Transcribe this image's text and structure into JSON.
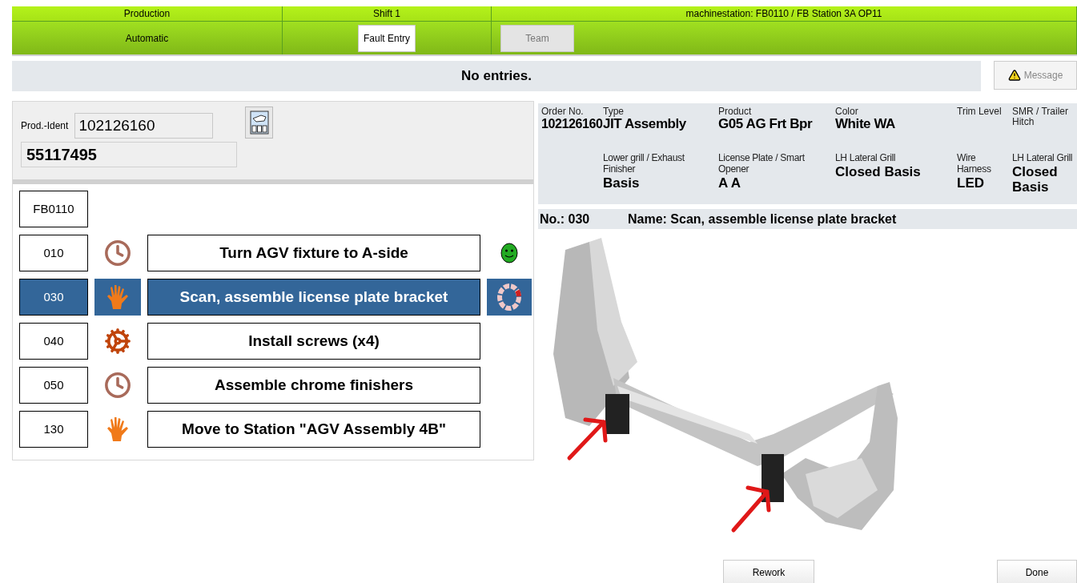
{
  "header": {
    "row_1": [
      "Production",
      "Shift 1",
      "machinestation: FB0110 / FB Station 3A OP11"
    ],
    "mode": "Automatic",
    "buttons": [
      {
        "label": "Fault Entry",
        "disabled": false
      },
      {
        "label": "Team",
        "disabled": true
      }
    ]
  },
  "message_bar": {
    "text": "No entries.",
    "button": {
      "label": "Message",
      "disabled": true
    }
  },
  "prod_ident": {
    "label": "Prod.-Ident",
    "value": "102126160",
    "second_value": "55117495"
  },
  "station": "FB0110",
  "steps": [
    {
      "number": "010",
      "kind": "timed",
      "name": "Turn AGV fixture to A-side",
      "status": {
        "kind": "ok"
      },
      "selected": false
    },
    {
      "number": "030",
      "kind": "manual",
      "name": "Scan, assemble license plate bracket",
      "status": {
        "kind": "running"
      },
      "selected": true
    },
    {
      "number": "040",
      "kind": "screwing",
      "name": "Install screws (x4)",
      "selected": false
    },
    {
      "number": "050",
      "kind": "timed",
      "name": "Assemble chrome finishers",
      "selected": false
    },
    {
      "number": "130",
      "kind": "manual",
      "name": "Move to Station \"AGV Assembly 4B\"",
      "selected": false
    }
  ],
  "order_info": {
    "row_1": [
      {
        "label": "Order No.",
        "value": "102126160"
      },
      {
        "label": "Type",
        "value": "JIT Assembly"
      },
      {
        "label": "Product",
        "value": "G05 AG Frt Bpr"
      },
      {
        "label": "Color",
        "value": "White WA"
      },
      {
        "label": "Trim Level"
      },
      {
        "label": "SMR / Trailer Hitch"
      }
    ],
    "row_2": [
      {
        "label": "Lower grill / Exhaust Finisher",
        "value": "Basis"
      },
      {
        "label": "License Plate / Smart Opener",
        "value": "A A"
      },
      {
        "label": "LH Lateral Grill",
        "value": "Closed Basis"
      },
      {
        "label": "Wire Harness",
        "value": "LED"
      },
      {
        "label": "LH Lateral Grill",
        "value": "Closed Basis"
      }
    ]
  },
  "current_step": {
    "number": "No.: 030",
    "name": "Name: Scan, assemble license plate bracket"
  },
  "actions": [
    {
      "label": "Rework"
    },
    {
      "label": "Done"
    }
  ]
}
